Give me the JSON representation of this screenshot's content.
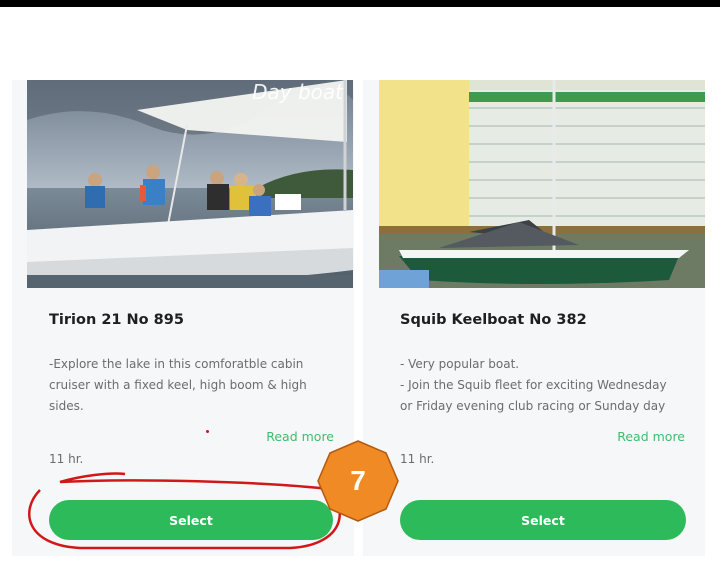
{
  "cards": [
    {
      "image_label": "Day boat",
      "title": "Tirion 21 No 895",
      "description": [
        "-Explore the lake in this comforatble cabin",
        "cruiser with a fixed keel, high boom & high",
        "sides."
      ],
      "read_more": "Read more",
      "duration": "11 hr.",
      "select_label": "Select"
    },
    {
      "image_label": "",
      "title": "Squib Keelboat No 382",
      "description": [
        "- Very popular boat.",
        "- Join the Squib fleet for exciting Wednesday",
        "or Friday evening club racing or Sunday day"
      ],
      "read_more": "Read more",
      "duration": "11 hr.",
      "select_label": "Select"
    }
  ],
  "annotation": {
    "step_number": "7",
    "badge_color": "#f08a24",
    "circle_color": "#d01818"
  },
  "colors": {
    "accent": "#2dba5a",
    "link": "#3cbf6b"
  }
}
